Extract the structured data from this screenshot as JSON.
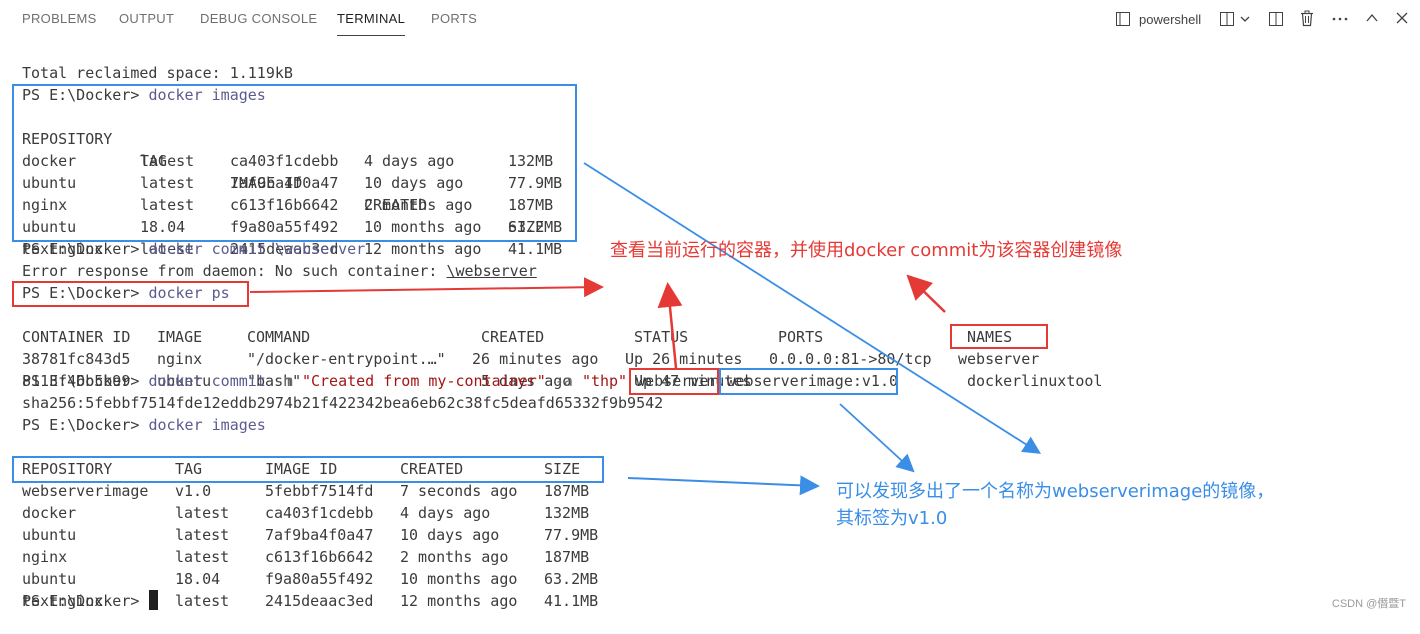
{
  "panel": {
    "tabs": [
      {
        "label": "PROBLEMS"
      },
      {
        "label": "OUTPUT"
      },
      {
        "label": "DEBUG CONSOLE"
      },
      {
        "label": "TERMINAL"
      },
      {
        "label": "PORTS"
      }
    ],
    "active_tab": "TERMINAL",
    "shell_name": "powershell"
  },
  "terminal": {
    "reclaimed": "Total reclaimed space: 1.119kB",
    "prompt": "PS E:\\Docker> ",
    "cmd_images": "docker images",
    "images_header": [
      "REPOSITORY",
      "TAG",
      "IMAGE ID",
      "CREATED",
      "SIZE"
    ],
    "images_before": [
      [
        "docker",
        "latest",
        "ca403f1cdebb",
        "4 days ago",
        "132MB"
      ],
      [
        "ubuntu",
        "latest",
        "7af9ba4f0a47",
        "10 days ago",
        "77.9MB"
      ],
      [
        "nginx",
        "latest",
        "c613f16b6642",
        "2 months ago",
        "187MB"
      ],
      [
        "ubuntu",
        "18.04",
        "f9a80a55f492",
        "10 months ago",
        "63.2MB"
      ],
      [
        "textnginx",
        "latest",
        "2415deaac3ed",
        "12 months ago",
        "41.1MB"
      ]
    ],
    "cmd_commit_fail": "docker commit \\webserver",
    "error_prefix": "Error response from daemon: No such container: ",
    "error_target": "\\webserver",
    "cmd_ps": "docker ps",
    "ps_header": [
      "CONTAINER ID",
      "IMAGE",
      "COMMAND",
      "CREATED",
      "STATUS",
      "PORTS",
      "NAMES"
    ],
    "ps_rows": [
      [
        "38781fc843d5",
        "nginx",
        "\"/docker-entrypoint.…\"",
        "26 minutes ago",
        "Up 26 minutes",
        "0.0.0.0:81->80/tcp",
        "webserver"
      ],
      [
        "8113f46b5b99",
        "ubuntu",
        "\"bash\"",
        "5 days ago",
        "Up 47 minutes",
        "",
        "dockerlinuxtool"
      ]
    ],
    "commit_cmd": "docker commit",
    "commit_m": "-m",
    "commit_msg": "\"Created from my-container\"",
    "commit_a": "-a",
    "commit_author": "\"thp\"",
    "commit_container": "webserver",
    "commit_image": "webserverimage:v1.0",
    "sha": "sha256:5febbf7514fde12eddb2974b21f422342bea6eb62c38fc5deafd65332f9b9542",
    "images_after": [
      [
        "webserverimage",
        "v1.0",
        "5febbf7514fd",
        "7 seconds ago",
        "187MB"
      ],
      [
        "docker",
        "latest",
        "ca403f1cdebb",
        "4 days ago",
        "132MB"
      ],
      [
        "ubuntu",
        "latest",
        "7af9ba4f0a47",
        "10 days ago",
        "77.9MB"
      ],
      [
        "nginx",
        "latest",
        "c613f16b6642",
        "2 months ago",
        "187MB"
      ],
      [
        "ubuntu",
        "18.04",
        "f9a80a55f492",
        "10 months ago",
        "63.2MB"
      ],
      [
        "textnginx",
        "latest",
        "2415deaac3ed",
        "12 months ago",
        "41.1MB"
      ]
    ]
  },
  "annotations": {
    "red_note": "查看当前运行的容器，并使用docker commit为该容器创建镜像",
    "blue_note_line1": "可以发现多出了一个名称为webserverimage的镜像，",
    "blue_note_line2": "其标签为v1.0",
    "red_color": "#e53935",
    "blue_color": "#3a8ee6"
  },
  "watermark": "CSDN @僭暨T",
  "icons": [
    "terminal-icon",
    "split-terminal-icon",
    "chevron-down-icon",
    "layout-icon",
    "trash-icon",
    "more-icon",
    "chevron-up-icon",
    "close-icon"
  ]
}
